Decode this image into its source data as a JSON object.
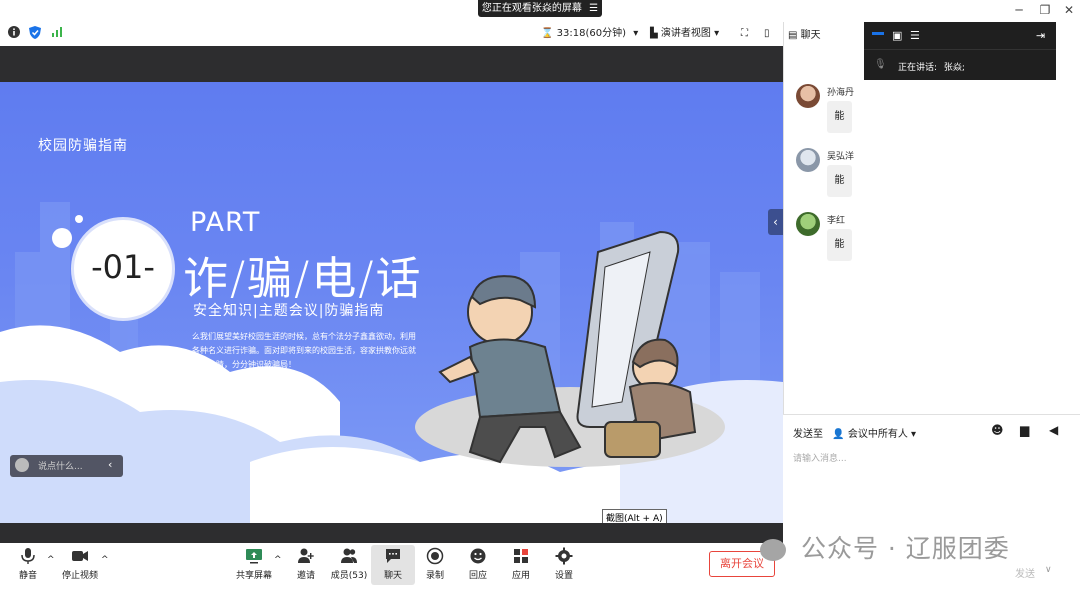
{
  "share_banner": "您正在观看张焱的屏幕",
  "toolbar": {
    "timer": "33:18(60分钟)",
    "view_mode": "演讲者视图",
    "chat_tab": "聊天"
  },
  "slide": {
    "header": "校园防骗指南",
    "number": "-01-",
    "part": "PART",
    "title": "诈/骗/电/话",
    "subtitle": "安全知识|主题会议|防骗指南",
    "description": "么我们展望美好校园生涯的时候，总有个法分子鑫鑫欲动，利用各种名义进行诈骗。面对即将到来的校园生活，容家拱教你远就火眼金睛，分分钟识破骗局！",
    "chat_placeholder": "说点什么...",
    "screenshot_tip": "截图(Alt + A)"
  },
  "controls": {
    "mute": "静音",
    "stop_video": "停止视频",
    "share_screen": "共享屏幕",
    "invite": "邀请",
    "members": "成员(53)",
    "chat": "聊天",
    "record": "录制",
    "reactions": "回应",
    "apps": "应用",
    "settings": "设置",
    "leave": "离开会议"
  },
  "speaker": {
    "label": "正在讲话:",
    "name": "张焱;"
  },
  "chat": {
    "messages": [
      {
        "name": "孙海丹",
        "text": "能"
      },
      {
        "name": "吴弘洋",
        "text": "能"
      },
      {
        "name": "李红",
        "text": "能"
      }
    ],
    "send_to_label": "发送至",
    "send_to_value": "会议中所有人",
    "input_placeholder": "请输入消息...",
    "send_button": "发送"
  },
  "watermark": "公众号 · 辽服团委",
  "colors": {
    "slide_blue": "#6a86f2",
    "leave_red": "#e8453c",
    "dark_bar": "#2d2d2f"
  }
}
